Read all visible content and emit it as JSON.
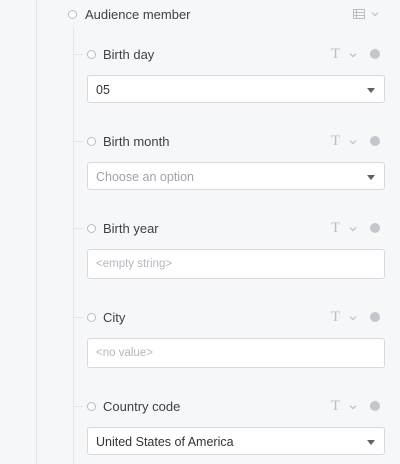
{
  "parent": {
    "label": "Audience member",
    "icon": "list-icon"
  },
  "fields": [
    {
      "label": "Birth day",
      "value": "05",
      "placeholder": "",
      "control": "select"
    },
    {
      "label": "Birth month",
      "value": "",
      "placeholder": "Choose an option",
      "control": "select"
    },
    {
      "label": "Birth year",
      "value": "",
      "placeholder": "<empty string>",
      "control": "text"
    },
    {
      "label": "City",
      "value": "",
      "placeholder": "<no value>",
      "control": "text"
    },
    {
      "label": "Country code",
      "value": "United States of America",
      "placeholder": "",
      "control": "select"
    }
  ],
  "type_icon_glyph": "T",
  "colors": {
    "background": "#f6f7f9",
    "border": "#d7d9de",
    "icon": "#b9bdc4"
  }
}
